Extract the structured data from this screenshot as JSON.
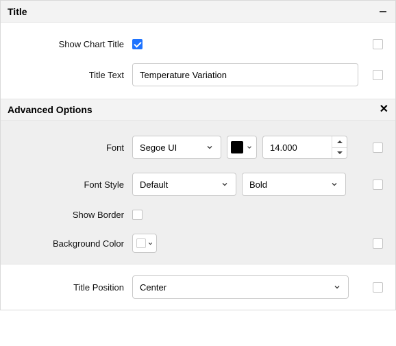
{
  "titleSection": {
    "header": "Title",
    "showChartTitle": {
      "label": "Show Chart Title",
      "checked": true
    },
    "titleText": {
      "label": "Title Text",
      "value": "Temperature Variation"
    }
  },
  "advancedSection": {
    "header": "Advanced Options",
    "font": {
      "label": "Font",
      "value": "Segoe UI",
      "color": "#000000",
      "size": "14.000"
    },
    "fontStyle": {
      "label": "Font Style",
      "style": "Default",
      "weight": "Bold"
    },
    "showBorder": {
      "label": "Show Border",
      "checked": false
    },
    "backgroundColor": {
      "label": "Background Color",
      "value": "#ffffff"
    },
    "titlePosition": {
      "label": "Title Position",
      "value": "Center"
    }
  }
}
